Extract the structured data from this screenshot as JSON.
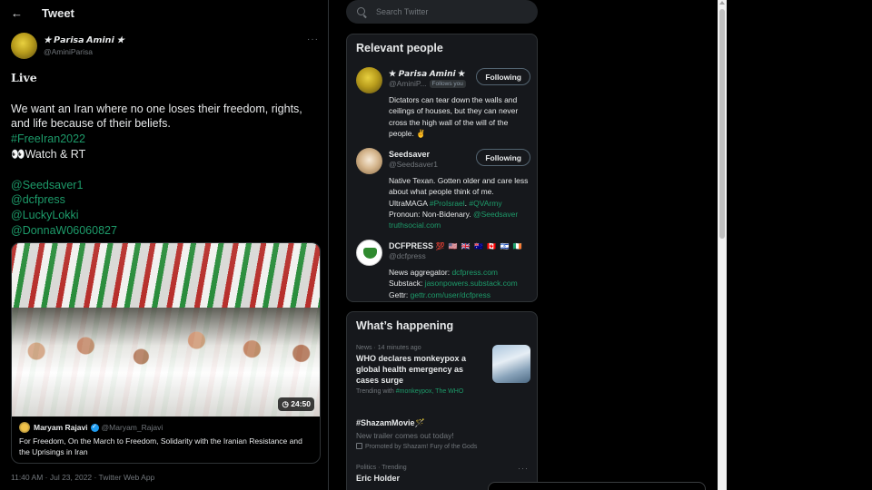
{
  "header": {
    "back_icon": "arrow-left-icon",
    "title": "Tweet"
  },
  "tweet": {
    "author_name": "★ 𝙋𝙖𝙧𝙞𝙨𝙖 𝘼𝙢𝙞𝙣𝙞 ★",
    "author_handle": "@AminiParisa",
    "more": "···",
    "live": "𝐋𝐢𝐯𝐞",
    "body": "We want an Iran where no one loses their freedom, rights, and life because of their beliefs.",
    "hashtag": "#FreeIran2022",
    "watch": "👀Watch & RT",
    "mentions": [
      "@Seedsaver1",
      "@dcfpress",
      "@LuckyLokki",
      "@DonnaW06060827"
    ],
    "media_duration": "24:50",
    "quote": {
      "name": "Maryam Rajavi",
      "handle": "@Maryam_Rajavi",
      "text": "For Freedom, On the March to Freedom, Solidarity with the Iranian Resistance and the Uprisings in Iran"
    },
    "timestamp": "11:40 AM · Jul 23, 2022 · Twitter Web App"
  },
  "search": {
    "placeholder": "Search Twitter"
  },
  "relevant": {
    "title": "Relevant people",
    "people": [
      {
        "name": "★ 𝙋𝙖𝙧𝙞𝙨𝙖 𝘼𝙢𝙞𝙣𝙞 ★",
        "handle": "@AminiP...",
        "follows_you": "Follows you",
        "button": "Following",
        "bio": "Dictators can tear down the walls and ceilings of houses, but they can never cross the high wall of the will of the people. ✌️"
      },
      {
        "name": "Seedsaver",
        "handle": "@Seedsaver1",
        "button": "Following",
        "bio_1": "Native Texan. Gotten older and care less about what people think of me. UltraMAGA ",
        "bio_tag1": "#ProIsrael",
        "bio_2": ". ",
        "bio_tag2": "#QVArmy",
        "bio_3": " Pronoun: Non-Bidenary. ",
        "bio_tag3": "@Seedsaver",
        "bio_link": "truthsocial.com"
      },
      {
        "name": "DCFPRESS",
        "name_flags": "💯 🇺🇸 🇬🇧 🇦🇺 🇨🇦 🇮🇱 🇮🇪",
        "handle": "@dcfpress",
        "line1_label": "News aggregator: ",
        "line1_link": "dcfpress.com",
        "line2_label": "Substack: ",
        "line2_link": "jasonpowers.substack.com",
        "line3_label": "Gettr: ",
        "line3_link": "gettr.com/user/dcfpress"
      }
    ]
  },
  "trends": {
    "title": "What’s happening",
    "items": [
      {
        "meta": "News · 14 minutes ago",
        "title": "WHO declares monkeypox a global health emergency as cases surge",
        "sub_label": "Trending with ",
        "sub_link": "#monkeypox, The WHO"
      },
      {
        "title": "#ShazamMovie🪄",
        "desc": "New trailer comes out today!",
        "promo": "Promoted by Shazam! Fury of the Gods"
      },
      {
        "meta": "Politics · Trending",
        "title": "Eric Holder",
        "more": "···"
      }
    ]
  }
}
